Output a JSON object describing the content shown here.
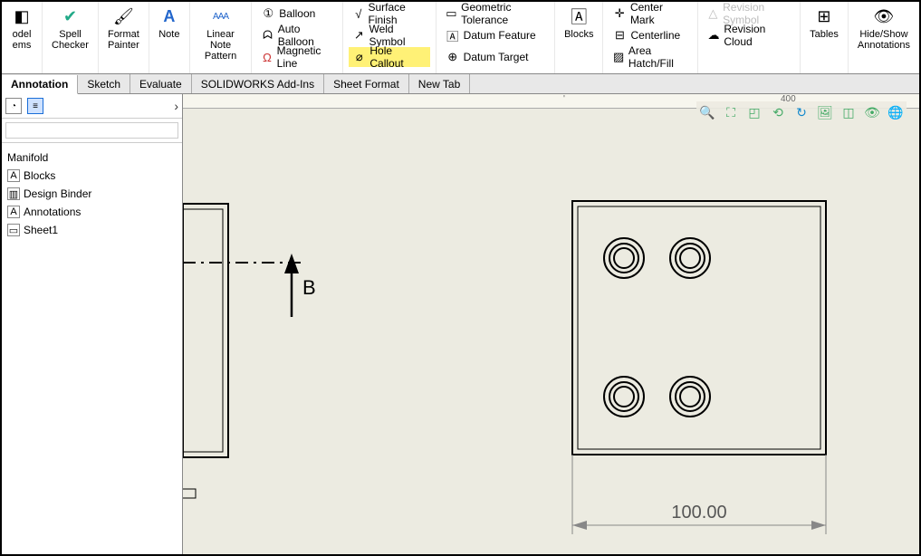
{
  "ribbon": {
    "model_items": "odel\nems",
    "spell_checker": "Spell\nChecker",
    "format_painter": "Format\nPainter",
    "note": "Note",
    "linear_note_pattern": "Linear Note\nPattern",
    "balloon": "Balloon",
    "auto_balloon": "Auto Balloon",
    "magnetic_line": "Magnetic Line",
    "surface_finish": "Surface Finish",
    "weld_symbol": "Weld Symbol",
    "hole_callout": "Hole Callout",
    "geometric_tolerance": "Geometric Tolerance",
    "datum_feature": "Datum Feature",
    "datum_target": "Datum Target",
    "blocks": "Blocks",
    "center_mark": "Center Mark",
    "centerline": "Centerline",
    "area_hatch": "Area Hatch/Fill",
    "revision_symbol": "Revision Symbol",
    "revision_cloud": "Revision Cloud",
    "tables": "Tables",
    "hide_show": "Hide/Show\nAnnotations"
  },
  "tabs": {
    "annotation": "Annotation",
    "sketch": "Sketch",
    "evaluate": "Evaluate",
    "addins": "SOLIDWORKS Add-Ins",
    "sheet_format": "Sheet Format",
    "new_tab": "New Tab"
  },
  "ruler": {
    "mark_400": "400"
  },
  "tree": {
    "root": "Manifold",
    "blocks": "Blocks",
    "design_binder": "Design Binder",
    "annotations": "Annotations",
    "sheet1": "Sheet1"
  },
  "drawing": {
    "section_label": "B",
    "dimension_100": "100.00"
  }
}
